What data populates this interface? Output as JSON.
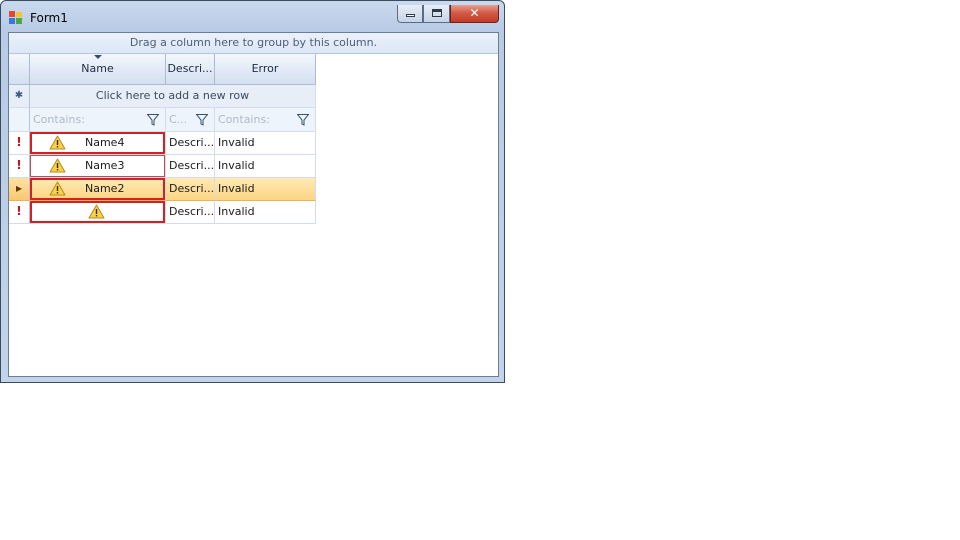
{
  "window": {
    "title": "Form1",
    "close_glyph": "✕"
  },
  "grid": {
    "group_panel_text": "Drag a column here to group by this column.",
    "columns": [
      {
        "header": "Name",
        "sorted": true
      },
      {
        "header": "Descri..."
      },
      {
        "header": "Error"
      }
    ],
    "add_row_symbol": "✱",
    "add_row_text": "Click here to add a new row",
    "filter": {
      "name_placeholder": "Contains:",
      "desc_placeholder": "C...",
      "error_placeholder": "Contains:"
    },
    "rows": [
      {
        "indicator": "!",
        "name": "Name4",
        "description": "Descri...",
        "error": "Invalid",
        "warning_icon": "warning-icon",
        "current": false
      },
      {
        "indicator": "!",
        "name": "Name3",
        "description": "Descri...",
        "error": "Invalid",
        "warning_icon": "warning-icon",
        "current": false
      },
      {
        "indicator": "▸",
        "name": "Name2",
        "description": "Descri...",
        "error": "Invalid",
        "warning_icon": "warning-icon",
        "current": true
      },
      {
        "indicator": "!",
        "name": "",
        "description": "Descri...",
        "error": "Invalid",
        "warning_icon": "warning-icon",
        "current": false
      }
    ]
  },
  "colors": {
    "error_border": "#d62020",
    "current_row": "#fdd583",
    "header_bg": "#dce7f6"
  }
}
